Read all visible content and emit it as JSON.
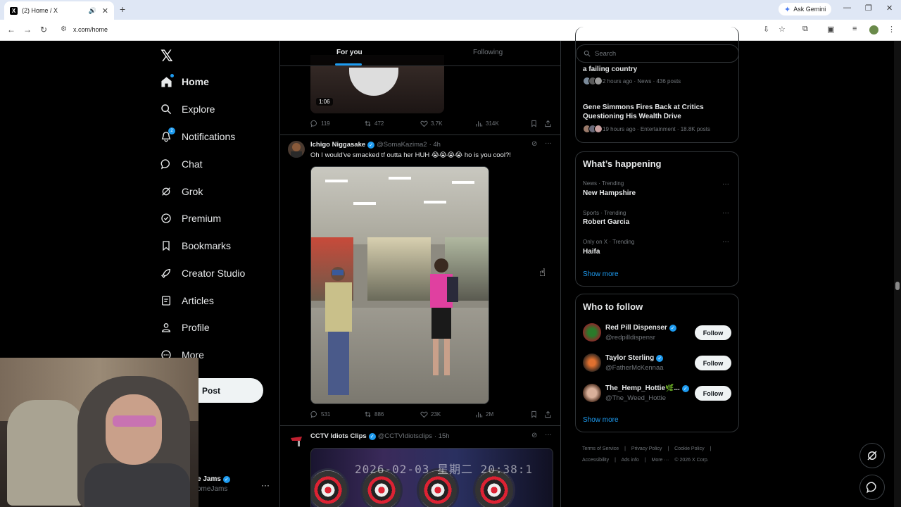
{
  "browser": {
    "tab_title": "(2) Home / X",
    "tab_close": "✕",
    "new_tab": "+",
    "gemini_label": "Ask Gemini",
    "url": "x.com/home"
  },
  "nav": {
    "logo": "𝕏",
    "items": [
      {
        "label": "Home",
        "icon": "home-icon"
      },
      {
        "label": "Explore",
        "icon": "search-icon"
      },
      {
        "label": "Notifications",
        "icon": "bell-icon",
        "badge": "2"
      },
      {
        "label": "Chat",
        "icon": "chat-icon"
      },
      {
        "label": "Grok",
        "icon": "grok-icon"
      },
      {
        "label": "Premium",
        "icon": "verified-icon"
      },
      {
        "label": "Bookmarks",
        "icon": "bookmark-icon"
      },
      {
        "label": "Creator Studio",
        "icon": "rocket-icon"
      },
      {
        "label": "Articles",
        "icon": "article-icon"
      },
      {
        "label": "Profile",
        "icon": "profile-icon"
      },
      {
        "label": "More",
        "icon": "more-icon"
      }
    ],
    "post_label": "Post",
    "account_name": "e Jams",
    "account_handle": "omeJams"
  },
  "feed": {
    "tabs": [
      "For you",
      "Following"
    ],
    "prev_tweet": {
      "duration": "1:06",
      "replies": "119",
      "reposts": "472",
      "likes": "3.7K",
      "views": "314K"
    },
    "tweet1": {
      "name": "Ichigo Niggasake",
      "handle": "@SomaKazima2",
      "time": "· 4h",
      "text": "Oh I would've smacked tf outta her HUH 😭😭😭😭 ho is you cool?!",
      "replies": "531",
      "reposts": "886",
      "likes": "23K",
      "views": "2M"
    },
    "tweet2": {
      "name": "CCTV Idiots Clips",
      "handle": "@CCTVIdiotsclips",
      "time": "· 15h",
      "media_timestamp": "2026-02-03 星期二 20:38:1"
    }
  },
  "right": {
    "search_placeholder": "Search",
    "news": [
      {
        "title": "a failing country",
        "meta": "2 hours ago · News · 436 posts"
      },
      {
        "title": "Gene Simmons Fires Back at Critics Questioning His Wealth Drive",
        "meta": "19 hours ago · Entertainment · 18.8K posts"
      }
    ],
    "happening": {
      "title": "What’s happening",
      "trends": [
        {
          "category": "News · Trending",
          "name": "New Hampshire"
        },
        {
          "category": "Sports · Trending",
          "name": "Robert Garcia"
        },
        {
          "category": "Only on X · Trending",
          "name": "Haifa"
        }
      ],
      "show_more": "Show more"
    },
    "who_to_follow": {
      "title": "Who to follow",
      "accounts": [
        {
          "name": "Red Pill Dispenser",
          "handle": "@redpilldispensr"
        },
        {
          "name": "Taylor Sterling",
          "handle": "@FatherMcKennaa"
        },
        {
          "name": "The_Hemp_Hottie🌿...",
          "handle": "@The_Weed_Hottie"
        }
      ],
      "follow_label": "Follow",
      "show_more": "Show more"
    },
    "footer": {
      "links": [
        "Terms of Service",
        "|",
        "Privacy Policy",
        "|",
        "Cookie Policy",
        "|",
        "Accessibility",
        "|",
        "Ads info",
        "|",
        "More ···",
        "© 2026 X Corp."
      ]
    }
  },
  "colors": {
    "accent": "#1d9bf0",
    "background": "#000000",
    "border": "#2f3336",
    "muted_text": "#71767b"
  }
}
